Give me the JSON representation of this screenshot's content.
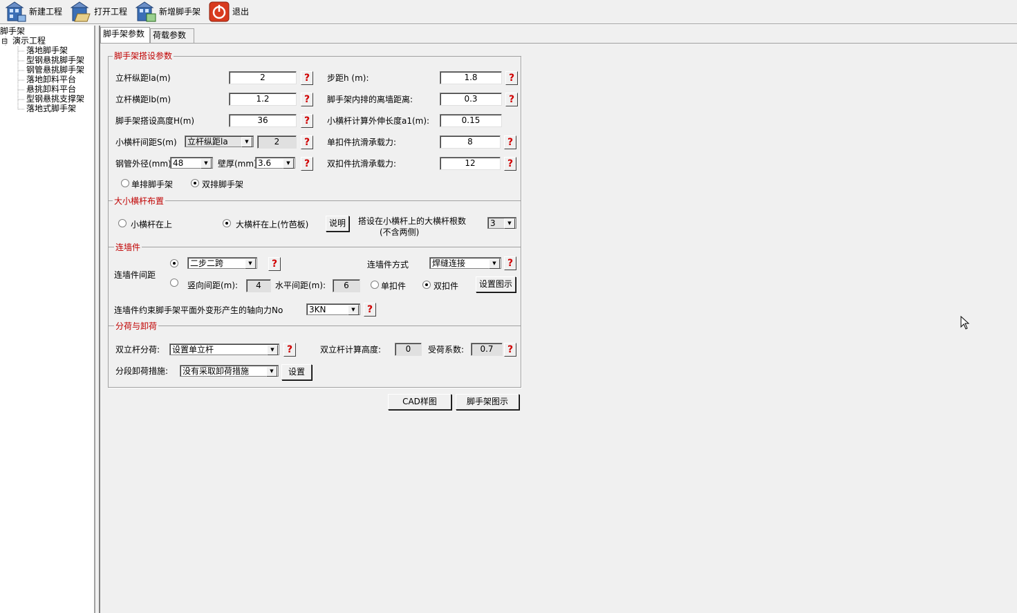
{
  "toolbar": {
    "new_project": "新建工程",
    "open_project": "打开工程",
    "add_scaffold": "新增脚手架",
    "exit": "退出"
  },
  "tree": {
    "root": "脚手架",
    "project": "演示工程",
    "project_toggle": "⊟",
    "items": [
      "落地脚手架",
      "型钢悬挑脚手架",
      "钢管悬挑脚手架",
      "落地卸料平台",
      "悬挑卸料平台",
      "型钢悬挑支撑架",
      "落地式脚手架"
    ]
  },
  "tabs": [
    "脚手架参数",
    "荷载参数"
  ],
  "section1": {
    "title": "脚手架搭设参数",
    "la_label": "立杆纵距la(m)",
    "la_value": "2",
    "lb_label": "立杆横距lb(m)",
    "lb_value": "1.2",
    "h_label": "脚手架搭设高度H(m)",
    "h_value": "36",
    "s_label": "小横杆间距S(m)",
    "s_select": "立杆纵距la",
    "s_value": "2",
    "pipe_label": "钢管外径(mm)",
    "pipe_value": "48",
    "wall_label": "壁厚(mm)",
    "wall_value": "3.6",
    "step_label": "步距h (m):",
    "step_value": "1.8",
    "inner_label": "脚手架内排的离墙距离:",
    "inner_value": "0.3",
    "a1_label": "小横杆计算外伸长度a1(m):",
    "a1_value": "0.15",
    "single_label": "单扣件抗滑承载力:",
    "single_value": "8",
    "double_label": "双扣件抗滑承载力:",
    "double_value": "12",
    "radio_single": "单排脚手架",
    "radio_double": "双排脚手架"
  },
  "section2": {
    "title": "大小横杆布置",
    "radio_small": "小横杆在上",
    "radio_big": "大横杆在上(竹芭板)",
    "explain": "说明",
    "count_label_1": "搭设在小横杆上的大横杆根数",
    "count_label_2": "(不含两侧)",
    "count_value": "3"
  },
  "section3": {
    "title": "连墙件",
    "spacing_label": "连墙件间距",
    "spacing_select": "二步二跨",
    "method_label": "连墙件方式",
    "method_value": "焊缝连接",
    "v_label": "竖向间距(m):",
    "v_value": "4",
    "h_label": "水平间距(m):",
    "h_value": "6",
    "radio_single": "单扣件",
    "radio_double": "双扣件",
    "setup_btn": "设置图示",
    "force_label": "连墙件约束脚手架平面外变形产生的轴向力No",
    "force_value": "3KN"
  },
  "section4": {
    "title": "分荷与卸荷",
    "split_label": "双立杆分荷:",
    "split_value": "设置单立杆",
    "calc_height_label": "双立杆计算高度:",
    "calc_height_value": "0",
    "coef_label": "受荷系数:",
    "coef_value": "0.7",
    "unload_label": "分段卸荷措施:",
    "unload_value": "没有采取卸荷措施",
    "setup_btn": "设置"
  },
  "buttons": {
    "cad": "CAD样图",
    "scaffold_diagram": "脚手架图示"
  },
  "help_glyph": "?",
  "arrow_glyph": "▼"
}
